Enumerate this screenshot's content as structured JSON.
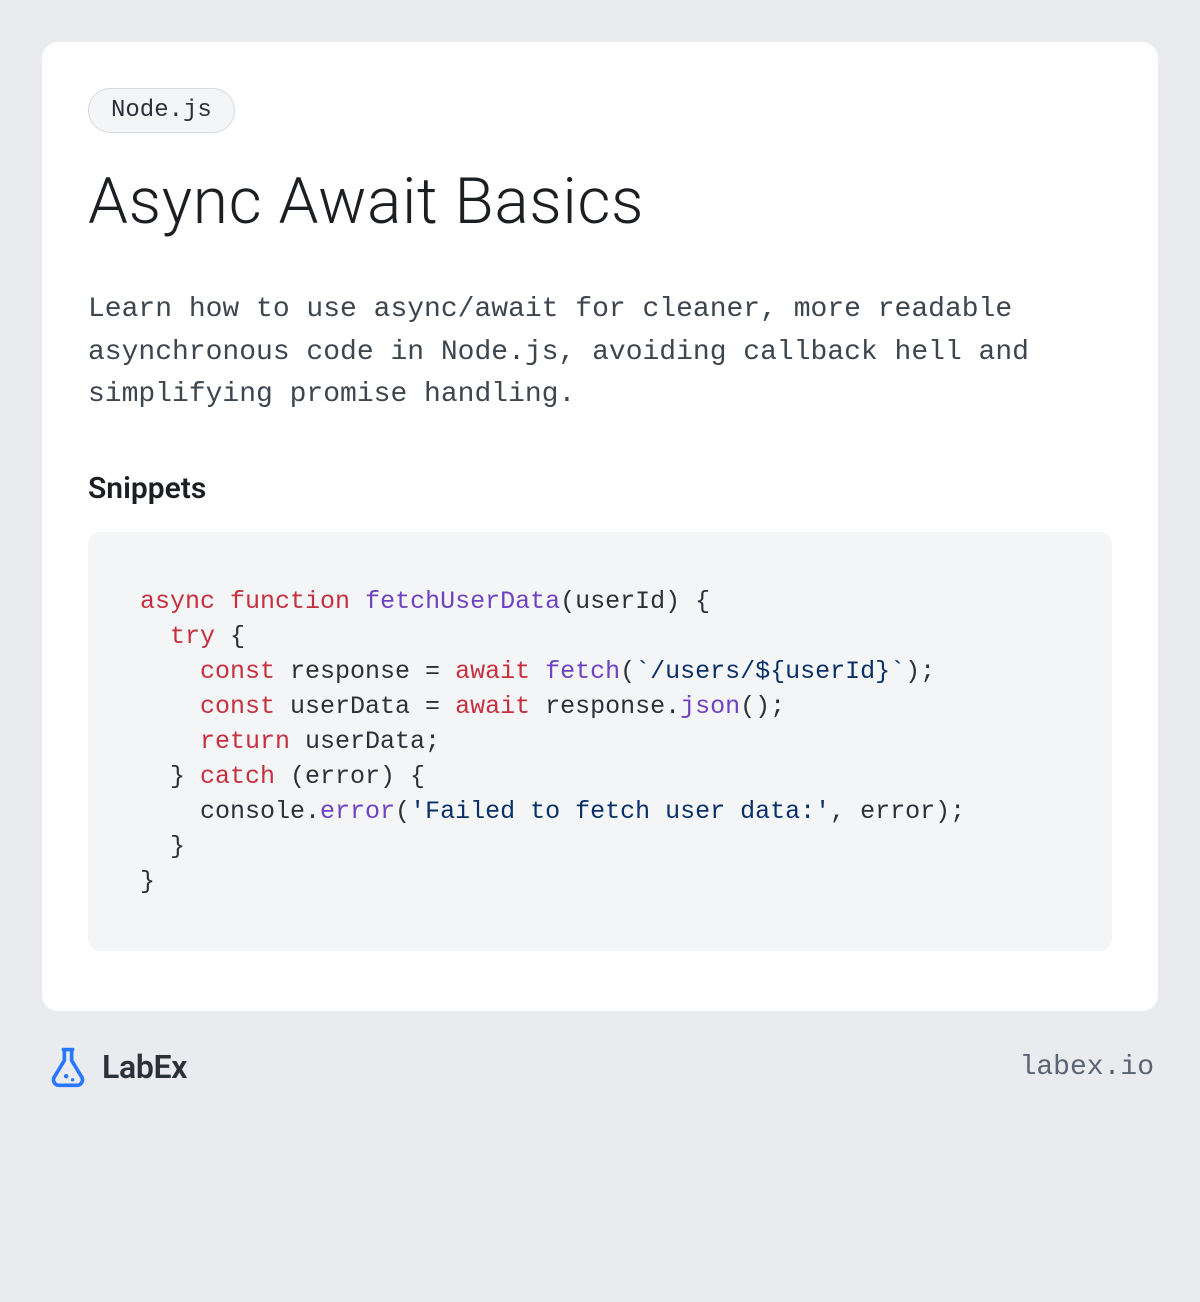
{
  "tag": "Node.js",
  "title": "Async Await Basics",
  "description": "Learn how to use async/await for cleaner, more readable asynchronous code in Node.js, avoiding callback hell and simplifying promise handling.",
  "snippets_heading": "Snippets",
  "code_plain": "async function fetchUserData(userId) {\n  try {\n    const response = await fetch(`/users/${userId}`);\n    const userData = await response.json();\n    return userData;\n  } catch (error) {\n    console.error('Failed to fetch user data:', error);\n  }\n}",
  "code_tokens": [
    {
      "t": "async",
      "c": "kw"
    },
    {
      "t": " "
    },
    {
      "t": "function",
      "c": "kw"
    },
    {
      "t": " "
    },
    {
      "t": "fetchUserData",
      "c": "fn"
    },
    {
      "t": "(userId) {\n  "
    },
    {
      "t": "try",
      "c": "kw"
    },
    {
      "t": " {\n    "
    },
    {
      "t": "const",
      "c": "kw"
    },
    {
      "t": " response = "
    },
    {
      "t": "await",
      "c": "kw"
    },
    {
      "t": " "
    },
    {
      "t": "fetch",
      "c": "call"
    },
    {
      "t": "("
    },
    {
      "t": "`/users/${userId}`",
      "c": "str"
    },
    {
      "t": ");\n    "
    },
    {
      "t": "const",
      "c": "kw"
    },
    {
      "t": " userData = "
    },
    {
      "t": "await",
      "c": "kw"
    },
    {
      "t": " response."
    },
    {
      "t": "json",
      "c": "call"
    },
    {
      "t": "();\n    "
    },
    {
      "t": "return",
      "c": "kw"
    },
    {
      "t": " userData;\n  } "
    },
    {
      "t": "catch",
      "c": "kw"
    },
    {
      "t": " (error) {\n    console."
    },
    {
      "t": "error",
      "c": "call"
    },
    {
      "t": "("
    },
    {
      "t": "'Failed to fetch user data:'",
      "c": "str"
    },
    {
      "t": ", error);\n  }\n}"
    }
  ],
  "brand": {
    "name": "LabEx",
    "site": "labex.io"
  },
  "colors": {
    "page_bg": "#e9ebee",
    "card_bg": "#ffffff",
    "code_bg": "#f4f5f7",
    "accent_blue": "#2877ff",
    "kw": "#c6303e",
    "fn": "#6f42c1",
    "str": "#0a3069"
  }
}
